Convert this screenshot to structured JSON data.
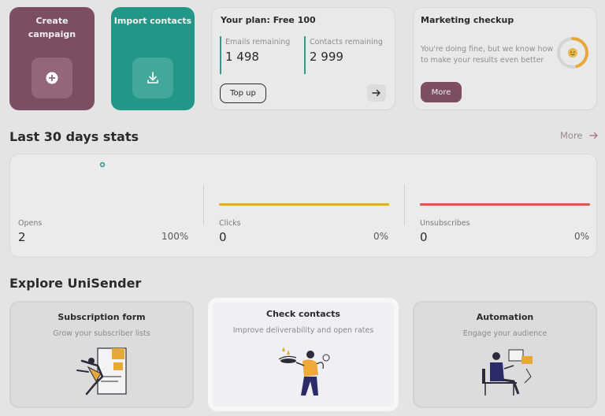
{
  "quick_actions": {
    "create_campaign": {
      "label_line1": "Create",
      "label_line2": "campaign",
      "icon": "plus-circle-icon"
    },
    "import_contacts": {
      "label": "Import contacts",
      "icon": "download-icon"
    }
  },
  "plan": {
    "title": "Your plan: Free 100",
    "emails_label": "Emails remaining",
    "emails_value": "1 498",
    "contacts_label": "Contacts remaining",
    "contacts_value": "2 999",
    "top_up_label": "Top up",
    "arrow_icon": "arrow-right-icon"
  },
  "checkup": {
    "title": "Marketing checkup",
    "description": "You're doing fine, but we know how to make your results even better",
    "more_label": "More",
    "gauge_fraction": 0.45,
    "gauge_color": "#e8a838"
  },
  "stats": {
    "title": "Last 30 days stats",
    "more_label": "More",
    "items": [
      {
        "label": "Opens",
        "value": "2",
        "percent": "100%",
        "color": "#2e9c8c"
      },
      {
        "label": "Clicks",
        "value": "0",
        "percent": "0%",
        "color": "#e8a838"
      },
      {
        "label": "Unsubscribes",
        "value": "0",
        "percent": "0%",
        "color": "#e05a4a"
      }
    ]
  },
  "explore": {
    "title": "Explore UniSender",
    "cards": [
      {
        "title": "Subscription form",
        "subtitle": "Grow your subscriber lists"
      },
      {
        "title": "Check contacts",
        "subtitle": "Improve deliverability and open rates"
      },
      {
        "title": "Automation",
        "subtitle": "Engage your audience"
      }
    ]
  },
  "colors": {
    "brand_plum": "#7d4d63",
    "brand_teal": "#229787",
    "accent_orange": "#e8a838"
  }
}
